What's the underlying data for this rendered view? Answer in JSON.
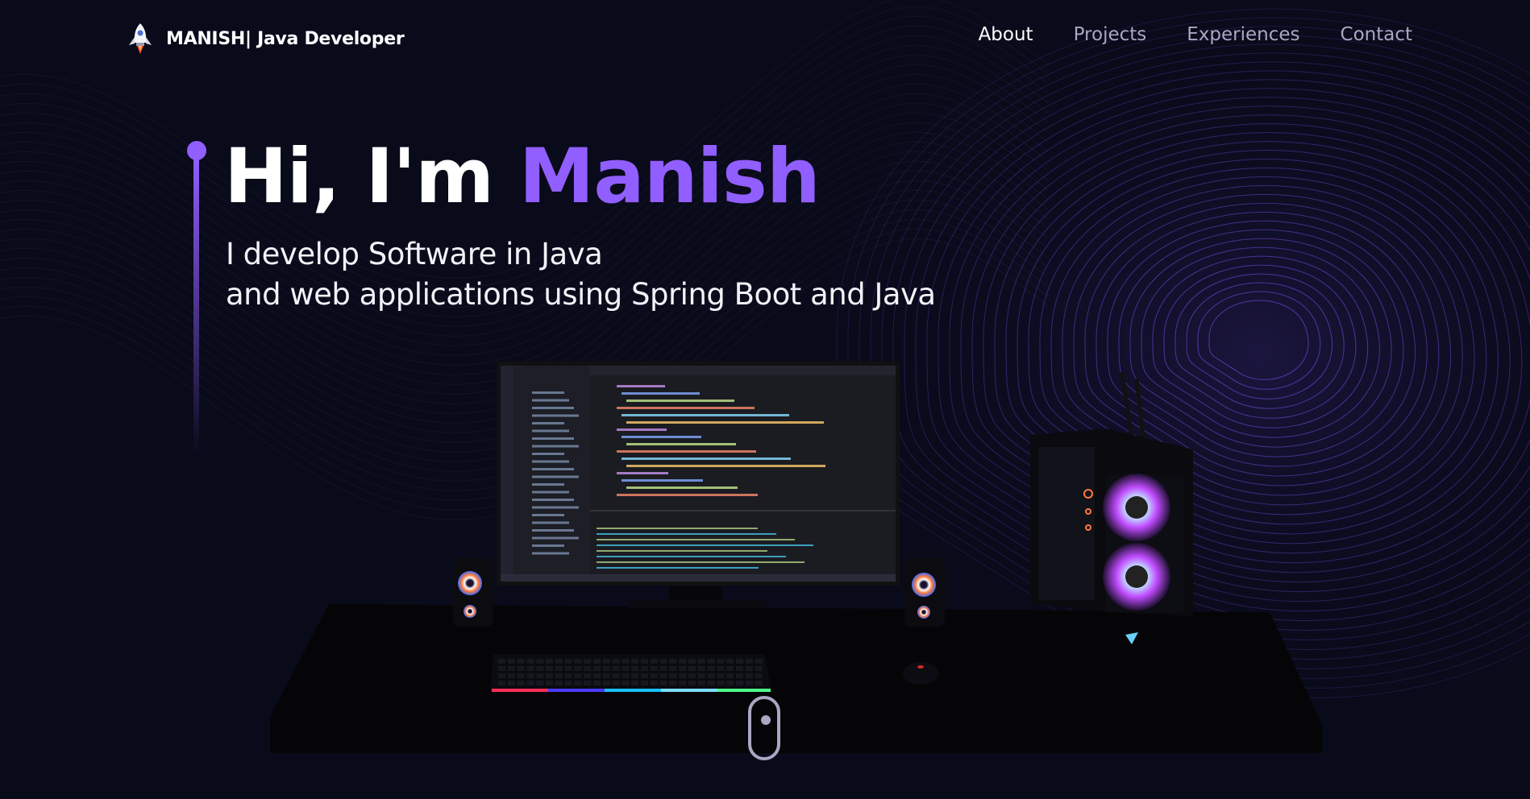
{
  "brand": {
    "name": "MANISH| Java Developer",
    "logo_icon": "rocket-icon"
  },
  "nav": {
    "items": [
      {
        "label": "About",
        "active": true
      },
      {
        "label": "Projects",
        "active": false
      },
      {
        "label": "Experiences",
        "active": false
      },
      {
        "label": "Contact",
        "active": false
      }
    ]
  },
  "hero": {
    "greeting": "Hi, I'm",
    "name": "Manish",
    "subtitle_line1": "I develop Software in Java",
    "subtitle_line2": "and web applications using Spring Boot and Java"
  },
  "scroll_indicator": {
    "icon": "mouse-scroll-icon"
  },
  "colors": {
    "background": "#090a1a",
    "accent": "#915eff",
    "nav_inactive": "#aaa6c3",
    "text": "#ffffff"
  }
}
